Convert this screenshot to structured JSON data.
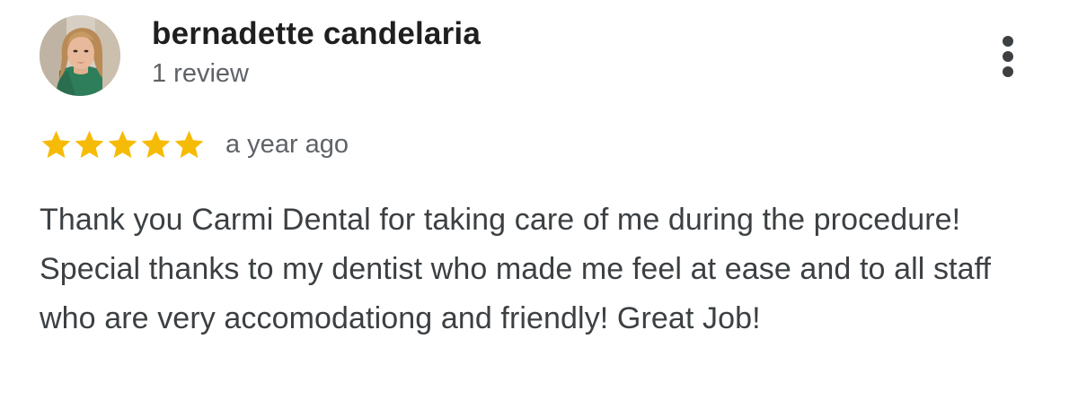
{
  "reviewer": {
    "name": "bernadette candelaria",
    "review_count": "1 review"
  },
  "rating": {
    "stars": 5,
    "max_stars": 5,
    "date": "a year ago"
  },
  "review": {
    "text": "Thank you Carmi Dental for taking care of me during the procedure! Special thanks to my dentist who made me feel at ease and to all staff who are very accomodationg and friendly! Great Job!"
  },
  "colors": {
    "star": "#F6BB06",
    "name": "#1f1f1f",
    "secondary": "#5f6368",
    "body_text": "#3c4043"
  },
  "icons": {
    "more": "more-vert-icon",
    "star": "star-icon"
  }
}
